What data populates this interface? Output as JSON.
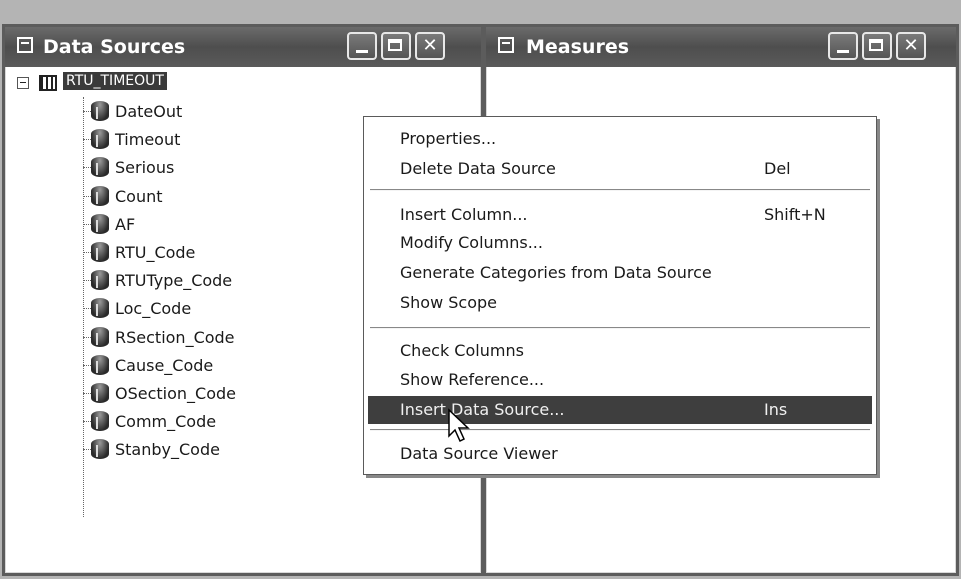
{
  "data_sources": {
    "title": "Data Sources",
    "root": "RTU_TIMEOUT",
    "columns": [
      "DateOut",
      "Timeout",
      "Serious",
      "Count",
      "AF",
      "RTU_Code",
      "RTUType_Code",
      "Loc_Code",
      "RSection_Code",
      "Cause_Code",
      "OSection_Code",
      "Comm_Code",
      "Stanby_Code"
    ]
  },
  "measures": {
    "title": "Measures"
  },
  "context_menu": {
    "items": [
      {
        "label": "Properties...",
        "shortcut": ""
      },
      {
        "label": "Delete Data Source",
        "shortcut": "Del"
      },
      {
        "label": "Insert Column...",
        "shortcut": "Shift+N"
      },
      {
        "label": "Modify Columns...",
        "shortcut": ""
      },
      {
        "label": "Generate Categories from Data Source",
        "shortcut": ""
      },
      {
        "label": "Show Scope",
        "shortcut": ""
      },
      {
        "label": "Check Columns",
        "shortcut": ""
      },
      {
        "label": "Show Reference...",
        "shortcut": ""
      },
      {
        "label": "Insert Data Source...",
        "shortcut": "Ins"
      },
      {
        "label": "Data Source Viewer",
        "shortcut": ""
      }
    ],
    "highlighted": "Insert Data Source..."
  },
  "icons": {
    "window_icon": "window-icon",
    "measures_icon": "measures-icon",
    "column_icon": "column-cylinder-icon",
    "table_icon": "table-icon",
    "cursor": "mouse-pointer-icon"
  },
  "colors": {
    "titlebar": "#555555",
    "highlight": "#3e3e3e",
    "background": "#b4b4b4"
  }
}
